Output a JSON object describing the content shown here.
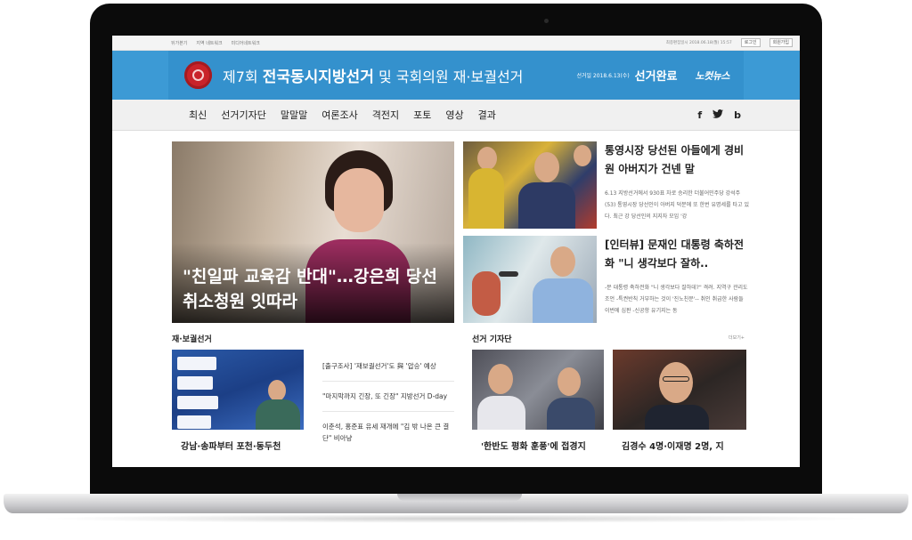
{
  "utility": {
    "left_links": [
      "뒤가본기",
      "지역 네트워크",
      "미디어네트워크"
    ],
    "updated": "최종편집일시 2018.06.18(월) 15:57",
    "login": "로그인",
    "join": "회원가입"
  },
  "banner": {
    "title_prefix": "제7회",
    "title_main": "전국동시지방선거",
    "title_suffix": "및 국회의원 재·보궐선거",
    "election_date": "선거일 2018.6.13(수)",
    "status": "선거완료",
    "logo": "노컷뉴스"
  },
  "nav": {
    "items": [
      "최신",
      "선거기자단",
      "말말말",
      "여론조사",
      "격전지",
      "포토",
      "영상",
      "결과"
    ],
    "social": {
      "facebook": "f",
      "twitter": "t",
      "blog": "b"
    }
  },
  "hero": {
    "headline": "\"친일파 교육감 반대\"…강은희 당선 취소청원 잇따라"
  },
  "side_stories": [
    {
      "title": "통영시장 당선된 아들에게 경비원 아버지가 건넨 말",
      "desc": "6.13 지방선거에서 930표 차로 승리한 더불어민주당 강석주(53) 통영시장 당선인이 아버지 덕분에 또 한번 유명세를 타고 있다. 최근 강 당선인의 지지자 모임 '강"
    },
    {
      "title": "[인터뷰] 문재인 대통령 축하전화 \"니 생각보다 잘하..",
      "desc": "-문 대통령 축하전화 \"니 생각보다 잘하데?\" 격려. 지역구 관리도 조언 -특권반칙 거부하는 것이 '진노친문'-- 취인 취급한 사람들 이번에 심판 -신공항 유기지는 동"
    }
  ],
  "sections": {
    "left_title": "재·보궐선거",
    "right_title": "선거 기자단",
    "more": "더보기+"
  },
  "by_election": {
    "caption": "강남·송파부터 포천·동두천",
    "links": [
      "[출구조사] '재보궐선거'도 與 '압승' 예상",
      "\"마지막까지 긴장, 또 긴장\" 지방선거 D-day",
      "이춘석, 홍준표 유세 재개에 \"김 밖 나온 큰 결단\" 비아냥"
    ]
  },
  "reporters": [
    {
      "caption": "'한반도 평화 훈풍'에 접경지"
    },
    {
      "caption": "김경수 4명·이재명 2명, 지"
    }
  ]
}
